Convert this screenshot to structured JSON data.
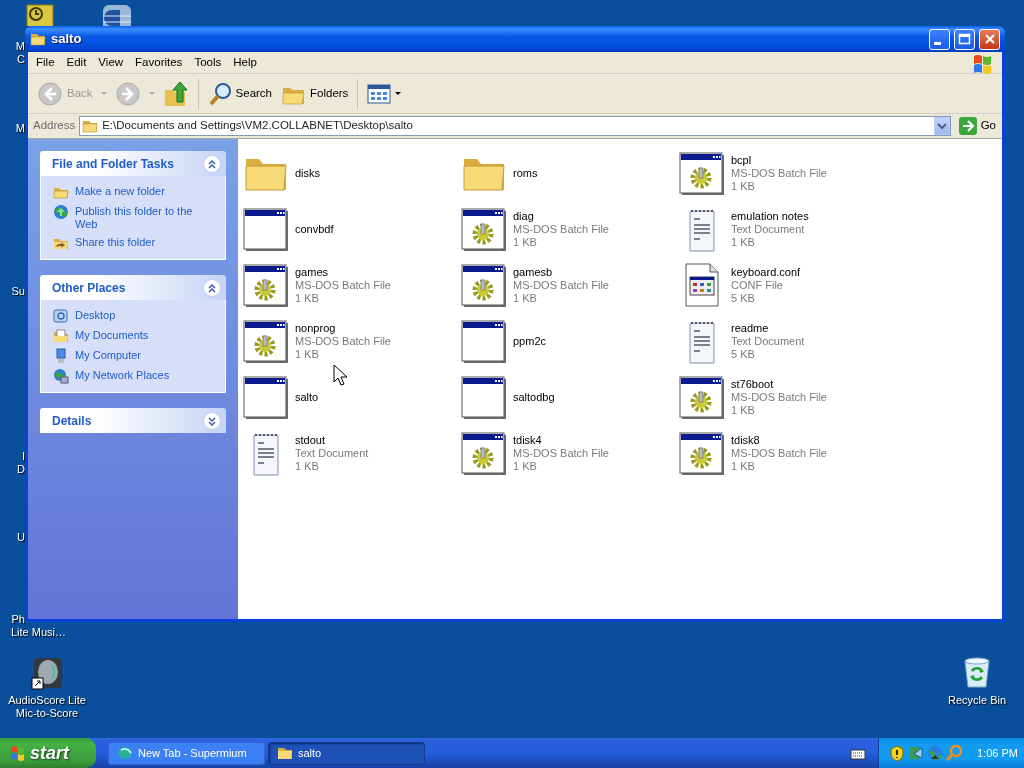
{
  "window": {
    "title": "salto"
  },
  "menu": [
    "File",
    "Edit",
    "View",
    "Favorites",
    "Tools",
    "Help"
  ],
  "toolbar": {
    "back": {
      "label": "Back",
      "disabled": true
    },
    "forward": {
      "disabled": true
    },
    "search": {
      "label": "Search"
    },
    "folders": {
      "label": "Folders"
    }
  },
  "address": {
    "label": "Address",
    "value": "E:\\Documents and Settings\\VM2.COLLABNET\\Desktop\\salto",
    "go": "Go"
  },
  "task_pane": [
    {
      "title": "File and Folder Tasks",
      "expanded": true,
      "items": [
        {
          "kind": "new-folder",
          "label": "Make a new folder"
        },
        {
          "kind": "globe",
          "label": "Publish this folder to the Web"
        },
        {
          "kind": "share",
          "label": "Share this folder"
        }
      ]
    },
    {
      "title": "Other Places",
      "expanded": true,
      "items": [
        {
          "kind": "desktop",
          "label": "Desktop"
        },
        {
          "kind": "documents",
          "label": "My Documents"
        },
        {
          "kind": "computer",
          "label": "My Computer"
        },
        {
          "kind": "network",
          "label": "My Network Places"
        }
      ]
    },
    {
      "title": "Details",
      "expanded": false
    }
  ],
  "files": [
    {
      "kind": "folder",
      "name": "disks"
    },
    {
      "kind": "folder",
      "name": "roms"
    },
    {
      "kind": "batch",
      "name": "bcpl",
      "type": "MS-DOS Batch File",
      "size": "1 KB"
    },
    {
      "kind": "program",
      "name": "convbdf"
    },
    {
      "kind": "batch",
      "name": "diag",
      "type": "MS-DOS Batch File",
      "size": "1 KB"
    },
    {
      "kind": "text",
      "name": "emulation notes",
      "type": "Text Document",
      "size": "1 KB"
    },
    {
      "kind": "batch",
      "name": "games",
      "type": "MS-DOS Batch File",
      "size": "1 KB"
    },
    {
      "kind": "batch",
      "name": "gamesb",
      "type": "MS-DOS Batch File",
      "size": "1 KB"
    },
    {
      "kind": "conf",
      "name": "keyboard.conf",
      "type": "CONF File",
      "size": "5 KB"
    },
    {
      "kind": "batch",
      "name": "nonprog",
      "type": "MS-DOS Batch File",
      "size": "1 KB"
    },
    {
      "kind": "program",
      "name": "ppm2c"
    },
    {
      "kind": "text",
      "name": "readme",
      "type": "Text Document",
      "size": "5 KB"
    },
    {
      "kind": "program",
      "name": "salto"
    },
    {
      "kind": "program",
      "name": "saltodbg"
    },
    {
      "kind": "batch",
      "name": "st76boot",
      "type": "MS-DOS Batch File",
      "size": "1 KB"
    },
    {
      "kind": "text",
      "name": "stdout",
      "type": "Text Document",
      "size": "1 KB"
    },
    {
      "kind": "batch",
      "name": "tdisk4",
      "type": "MS-DOS Batch File",
      "size": "1 KB"
    },
    {
      "kind": "batch",
      "name": "tdisk8",
      "type": "MS-DOS Batch File",
      "size": "1 KB"
    }
  ],
  "desktop": {
    "cut_labels": [
      "M",
      "C",
      "M",
      "Su",
      "I",
      "D",
      "U",
      "Ph",
      "Lite Musi…"
    ],
    "icons": [
      {
        "kind": "shortcut",
        "label": [
          "AudioScore Lite",
          "Mic-to-Score"
        ]
      },
      {
        "kind": "recycle",
        "label": [
          "Recycle Bin"
        ]
      }
    ]
  },
  "taskbar": {
    "start": "start",
    "tasks": [
      {
        "kind": "browser",
        "label": "New Tab - Supermium",
        "selected": false
      },
      {
        "kind": "folder",
        "label": "salto",
        "selected": true
      }
    ],
    "clock": "1:06 PM"
  }
}
